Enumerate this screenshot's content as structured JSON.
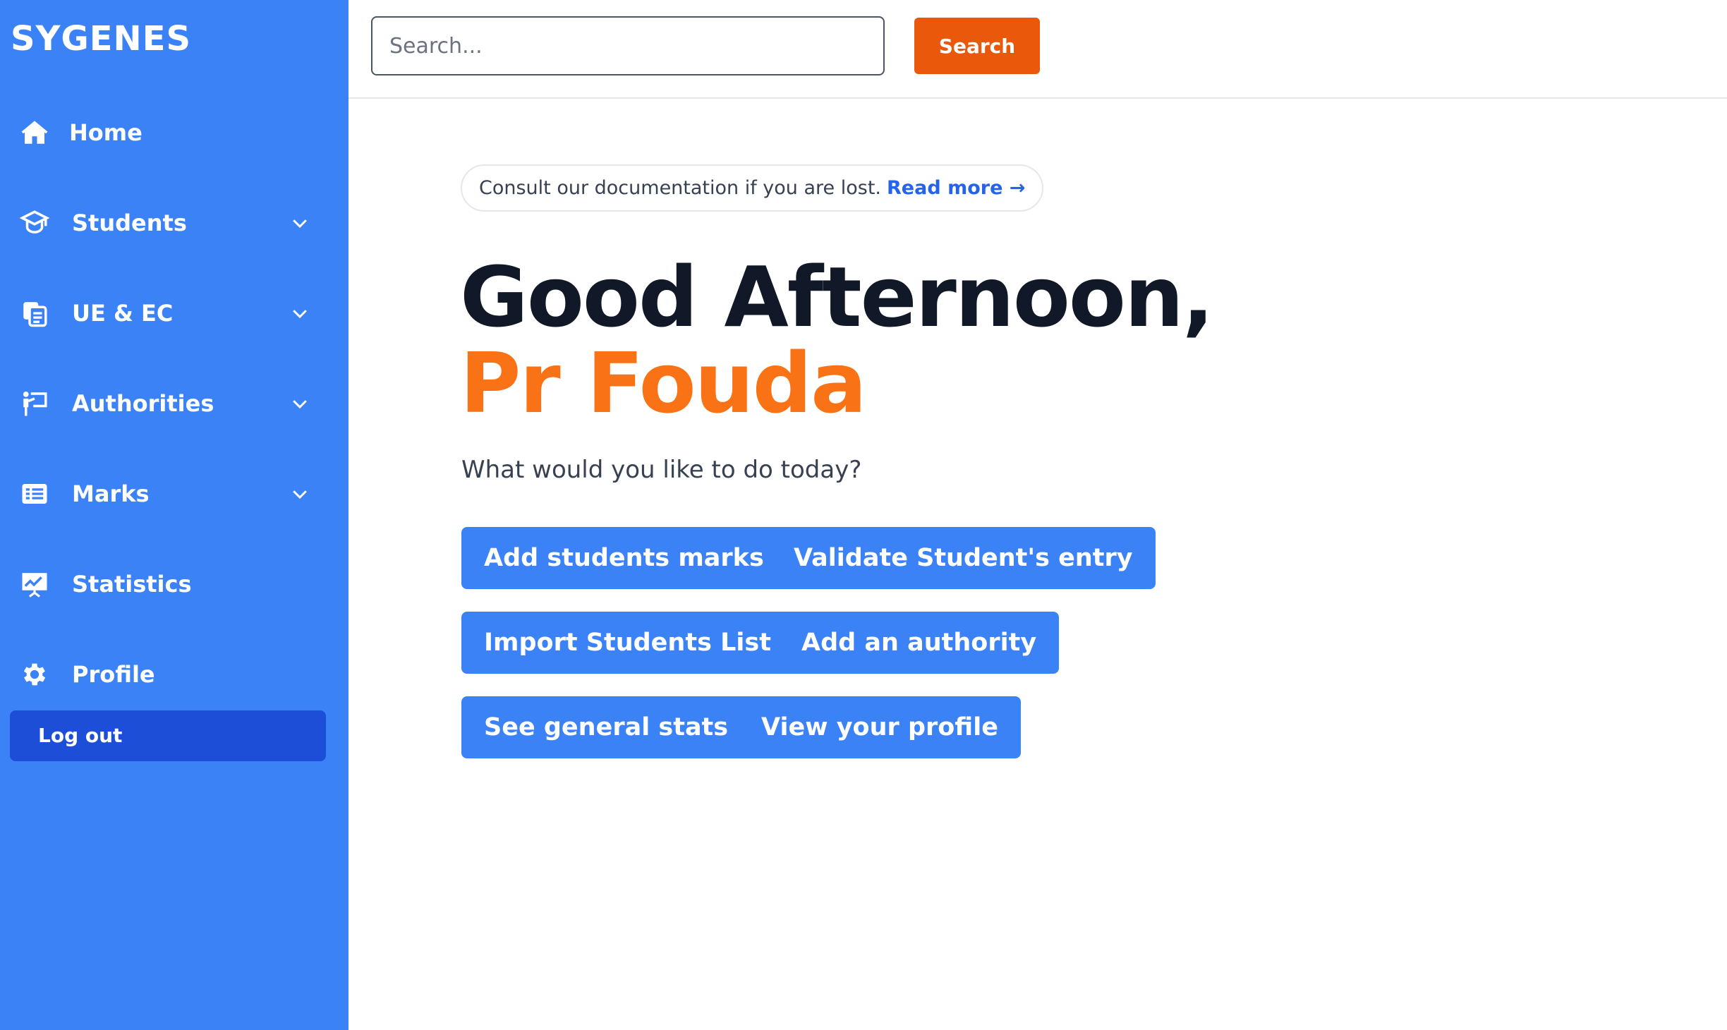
{
  "app": {
    "brand": "SYGENES"
  },
  "sidebar": {
    "items": [
      {
        "label": "Home",
        "icon": "home-icon",
        "has_dropdown": false
      },
      {
        "label": "Students",
        "icon": "graduation-cap-icon",
        "has_dropdown": true
      },
      {
        "label": "UE & EC",
        "icon": "documents-icon",
        "has_dropdown": true
      },
      {
        "label": "Authorities",
        "icon": "presenter-icon",
        "has_dropdown": true
      },
      {
        "label": "Marks",
        "icon": "list-card-icon",
        "has_dropdown": true
      },
      {
        "label": "Statistics",
        "icon": "chart-board-icon",
        "has_dropdown": false
      },
      {
        "label": "Profile",
        "icon": "gear-icon",
        "has_dropdown": false
      }
    ],
    "logout_label": "Log out"
  },
  "header": {
    "search_placeholder": "Search...",
    "search_value": "",
    "search_button": "Search"
  },
  "main": {
    "doc_notice": "Consult our documentation if you are lost.",
    "doc_link": "Read more →",
    "greeting": "Good Afternoon,",
    "name": "Pr Fouda",
    "prompt": "What would you like to do today?",
    "actions": [
      "Add students marks",
      "Validate Student's entry",
      "Import Students List",
      "Add an authority",
      "See general stats",
      "View your profile"
    ]
  },
  "colors": {
    "sidebar_bg": "#3b82f6",
    "logout_bg": "#1d4ed8",
    "search_button_bg": "#ea580c",
    "name_accent": "#f97316",
    "action_button_bg": "#3b82f6",
    "link": "#2563eb"
  }
}
